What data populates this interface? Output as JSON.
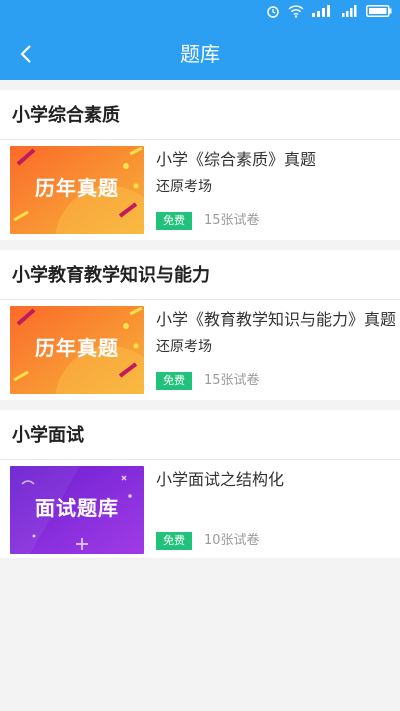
{
  "header": {
    "title": "题库"
  },
  "sections": [
    {
      "title": "小学综合素质",
      "card": {
        "thumb_text": "历年真题",
        "title": "小学《综合素质》真题",
        "subtitle": "还原考场",
        "badge": "免费",
        "count": "15张试卷"
      }
    },
    {
      "title": "小学教育教学知识与能力",
      "card": {
        "thumb_text": "历年真题",
        "title": "小学《教育教学知识与能力》真题",
        "subtitle": "还原考场",
        "badge": "免费",
        "count": "15张试卷"
      }
    },
    {
      "title": "小学面试",
      "card": {
        "thumb_text": "面试题库",
        "title": "小学面试之结构化",
        "subtitle": "",
        "badge": "免费",
        "count": "10张试卷"
      }
    }
  ],
  "colors": {
    "primary": "#2d9ff3",
    "badge": "#21c27b",
    "thumb_orange": "#f6882a",
    "thumb_purple": "#7b2cd9"
  }
}
